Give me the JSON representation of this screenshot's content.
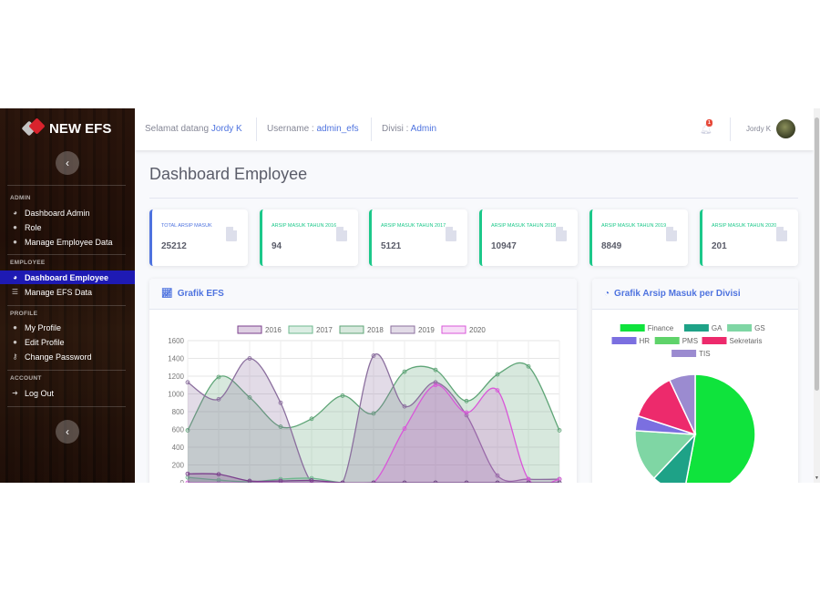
{
  "brand": {
    "name": "NEW EFS"
  },
  "sidebar": {
    "sections": [
      {
        "heading": "ADMIN",
        "items": [
          {
            "label": "Dashboard Admin",
            "icon": "tachometer-icon"
          },
          {
            "label": "Role",
            "icon": "user-icon"
          },
          {
            "label": "Manage Employee Data",
            "icon": "user-edit-icon"
          }
        ]
      },
      {
        "heading": "EMPLOYEE",
        "items": [
          {
            "label": "Dashboard Employee",
            "icon": "tachometer-icon",
            "active": true
          },
          {
            "label": "Manage EFS Data",
            "icon": "list-icon"
          }
        ]
      },
      {
        "heading": "PROFILE",
        "items": [
          {
            "label": "My Profile",
            "icon": "user-icon"
          },
          {
            "label": "Edit Profile",
            "icon": "user-edit-icon"
          },
          {
            "label": "Change Password",
            "icon": "key-icon"
          }
        ]
      },
      {
        "heading": "ACCOUNT",
        "items": [
          {
            "label": "Log Out",
            "icon": "sign-out-icon"
          }
        ]
      }
    ],
    "collapse_icon": "chevron-left-icon"
  },
  "topbar": {
    "welcome_prefix": "Selamat datang ",
    "welcome_name": "Jordy K",
    "username_prefix": "Username : ",
    "username_value": "admin_efs",
    "divisi_prefix": "Divisi : ",
    "divisi_value": "Admin",
    "notification_count": "1",
    "user_name": "Jordy K"
  },
  "page": {
    "title": "Dashboard Employee"
  },
  "stats": [
    {
      "label": "TOTAL ARSIP MASUK",
      "value": "25212",
      "accent": "#4e73df"
    },
    {
      "label": "ARSIP MASUK TAHUN 2016",
      "value": "94",
      "accent": "#1cc88a"
    },
    {
      "label": "ARSIP MASUK TAHUN 2017",
      "value": "5121",
      "accent": "#1cc88a"
    },
    {
      "label": "ARSIP MASUK TAHUN 2018",
      "value": "10947",
      "accent": "#1cc88a"
    },
    {
      "label": "ARSIP MASUK TAHUN 2019",
      "value": "8849",
      "accent": "#1cc88a"
    },
    {
      "label": "ARSIP MASUK TAHUN 2020",
      "value": "201",
      "accent": "#1cc88a"
    }
  ],
  "cards": {
    "line_title": "Grafik EFS",
    "pie_title": "Grafik Arsip Masuk per Divisi"
  },
  "colors": {
    "primary": "#4e73df",
    "success": "#1cc88a",
    "sidebar_active": "#1e1ab3"
  },
  "chart_data": [
    {
      "type": "area",
      "title": "Grafik EFS",
      "yticks": [
        0,
        200,
        400,
        600,
        800,
        1000,
        1200,
        1400,
        1600
      ],
      "ylim": [
        0,
        1600
      ],
      "grid": true,
      "legend": "top",
      "series": [
        {
          "name": "2016",
          "color": "#7b3f8c",
          "fill": "rgba(123,63,140,0.25)",
          "values": [
            100,
            95,
            20,
            20,
            25,
            0,
            0,
            0,
            0,
            0,
            0,
            0,
            0
          ]
        },
        {
          "name": "2017",
          "color": "#6fb98f",
          "fill": "rgba(111,185,143,0.25)",
          "values": [
            60,
            30,
            10,
            40,
            50,
            0,
            0,
            0,
            0,
            0,
            0,
            0,
            0
          ]
        },
        {
          "name": "2018",
          "color": "#5fa577",
          "fill": "rgba(95,165,119,0.25)",
          "values": [
            590,
            1190,
            960,
            630,
            720,
            980,
            780,
            1250,
            1270,
            920,
            1220,
            1310,
            590
          ]
        },
        {
          "name": "2019",
          "color": "#8b6f9e",
          "fill": "rgba(139,111,158,0.25)",
          "values": [
            1130,
            940,
            1400,
            900,
            0,
            0,
            1430,
            860,
            1130,
            760,
            80,
            40,
            40
          ]
        },
        {
          "name": "2020",
          "color": "#d957d9",
          "fill": "rgba(217,87,217,0.2)",
          "values": [
            0,
            0,
            0,
            0,
            0,
            0,
            0,
            610,
            1100,
            790,
            1040,
            40,
            40
          ]
        }
      ]
    },
    {
      "type": "pie",
      "title": "Grafik Arsip Masuk per Divisi",
      "legend": "top",
      "labels": [
        "Finance",
        "GA",
        "GS",
        "HR",
        "PMS",
        "Sekretaris",
        "TIS"
      ],
      "colors": [
        "#0fe33c",
        "#1ea287",
        "#7fd6a4",
        "#7b6fe0",
        "#5fd36a",
        "#ed2a6c",
        "#9b8bd0"
      ],
      "values": [
        53,
        9,
        14,
        4,
        0,
        13,
        7
      ]
    }
  ]
}
